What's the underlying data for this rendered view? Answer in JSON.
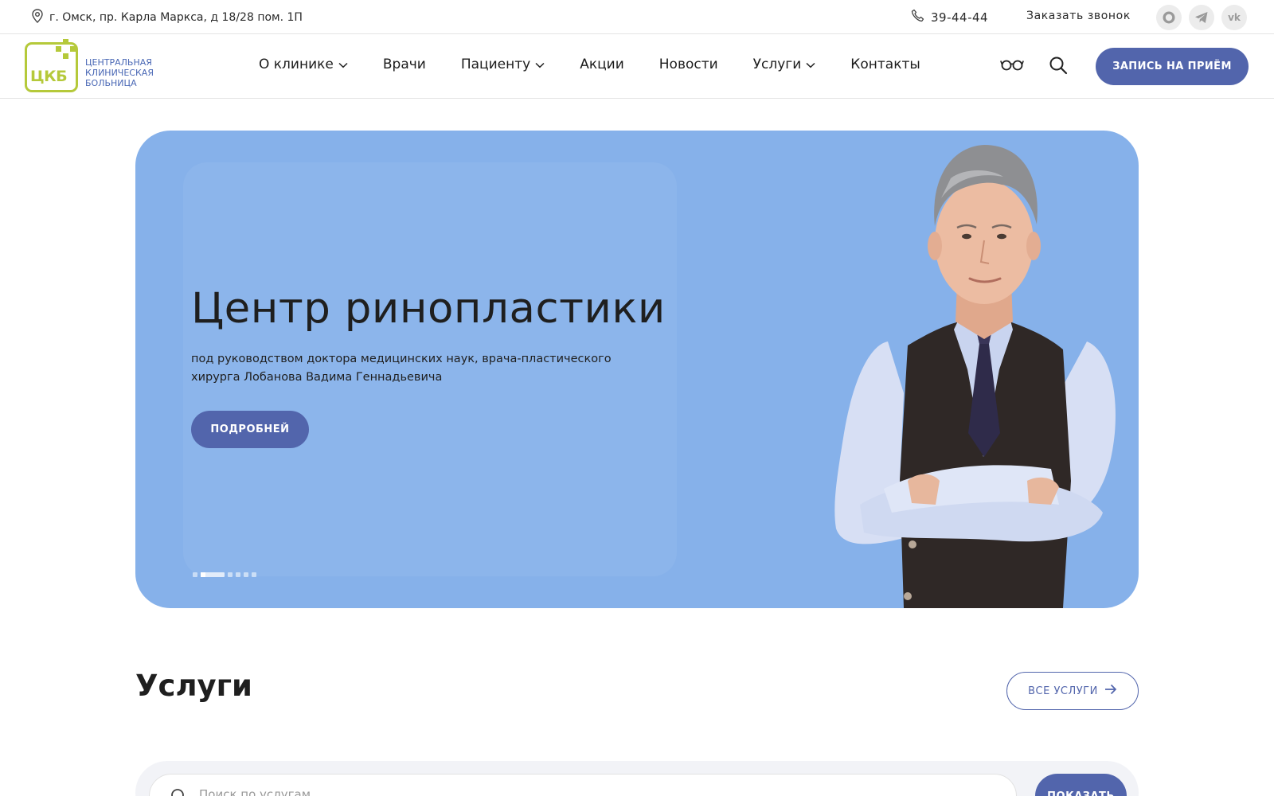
{
  "topbar": {
    "address": "г. Омск, пр. Карла Маркса, д 18/28 пом. 1П",
    "phone": "39-44-44",
    "callback": "Заказать звонок",
    "socials": [
      "messenger-icon",
      "telegram-icon",
      "vk-icon"
    ]
  },
  "logo": {
    "abbr": "ЦКБ",
    "line1": "ЦЕНТРАЛЬНАЯ",
    "line2": "КЛИНИЧЕСКАЯ",
    "line3": "БОЛЬНИЦА"
  },
  "nav": {
    "items": [
      {
        "label": "О клинике",
        "has_dropdown": true
      },
      {
        "label": "Врачи",
        "has_dropdown": false
      },
      {
        "label": "Пациенту",
        "has_dropdown": true
      },
      {
        "label": "Акции",
        "has_dropdown": false
      },
      {
        "label": "Новости",
        "has_dropdown": false
      },
      {
        "label": "Услуги",
        "has_dropdown": true
      },
      {
        "label": "Контакты",
        "has_dropdown": false
      }
    ]
  },
  "header": {
    "appointment_label": "ЗАПИСЬ НА ПРИЁМ"
  },
  "hero": {
    "title": "Центр ринопластики",
    "subtitle": "под руководством доктора медицинских наук, врача-пластического хирурга Лобанова Вадима Геннадьевича",
    "button_label": "ПОДРОБНЕЙ",
    "slide_count": 7,
    "active_slide": 2
  },
  "services": {
    "title": "Услуги",
    "all_label": "ВСЕ УСЛУГИ",
    "search_placeholder": "Поиск по услугам",
    "show_label": "ПОКАЗАТЬ"
  },
  "colors": {
    "accent": "#5265ac",
    "brand_green": "#b5c93a",
    "hero_bg": "#86b1ea"
  }
}
